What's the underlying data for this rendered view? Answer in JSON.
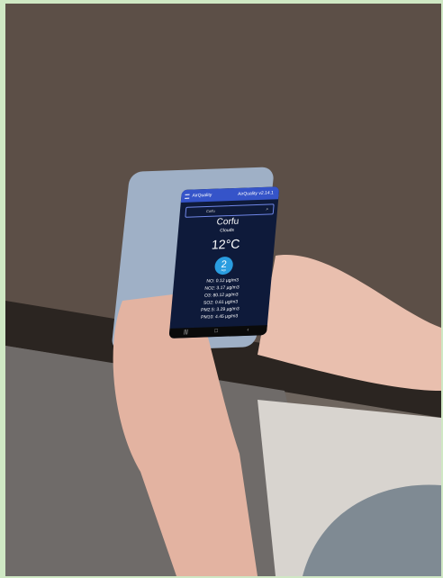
{
  "app": {
    "title": "AirQuality",
    "version": "AirQuality v2.14.1",
    "search_value": "Corfu",
    "search_icon": "search-icon",
    "city": "Corfu",
    "condition": "Clouds",
    "temperature": "12°C",
    "aqi_value": "2",
    "aqi_label": "AQI",
    "pollutants": [
      "NO: 0.12 µg/m3",
      "NO2: 3.17 µg/m3",
      "O3: 80.12 µg/m3",
      "SO2: 0.61 µg/m3",
      "PM2.5: 3.29 µg/m3",
      "PM10: 4.45 µg/m3"
    ]
  }
}
